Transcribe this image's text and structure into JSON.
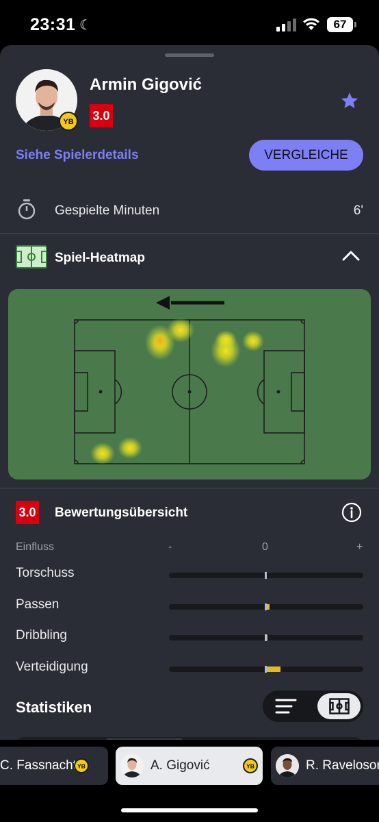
{
  "status_bar": {
    "time": "23:31",
    "battery": "67"
  },
  "player": {
    "name": "Armin Gigović",
    "rating": "3.0",
    "details_link": "Siehe Spielerdetails",
    "compare_button": "VERGLEICHE",
    "favorite_icon": "star-icon"
  },
  "minutes": {
    "label": "Gespielte Minuten",
    "value": "6'"
  },
  "heatmap": {
    "title": "Spiel-Heatmap",
    "direction": "left",
    "pitch_color": "#4a7a4c",
    "heat_color": "#f2e21a"
  },
  "rating_overview": {
    "rating": "3.0",
    "title": "Bewertungsübersicht",
    "scale": {
      "label": "Einfluss",
      "minus": "-",
      "zero": "0",
      "plus": "+"
    },
    "attributes": [
      {
        "label": "Torschuss",
        "impact": 0.0
      },
      {
        "label": "Passen",
        "impact": 0.03
      },
      {
        "label": "Dribbling",
        "impact": 0.01
      },
      {
        "label": "Verteidigung",
        "impact": 0.14
      }
    ]
  },
  "stats": {
    "title": "Statistiken"
  },
  "switcher": {
    "players": [
      {
        "name": "C. Fassnacht",
        "active": false
      },
      {
        "name": "A. Gigović",
        "active": true
      },
      {
        "name": "R. Ravelosor",
        "active": false
      }
    ]
  },
  "colors": {
    "accent": "#7d7ff5",
    "rating_red": "#d8000e",
    "impact_yellow": "#e6b91c",
    "sheet_bg": "#2a2d35"
  }
}
